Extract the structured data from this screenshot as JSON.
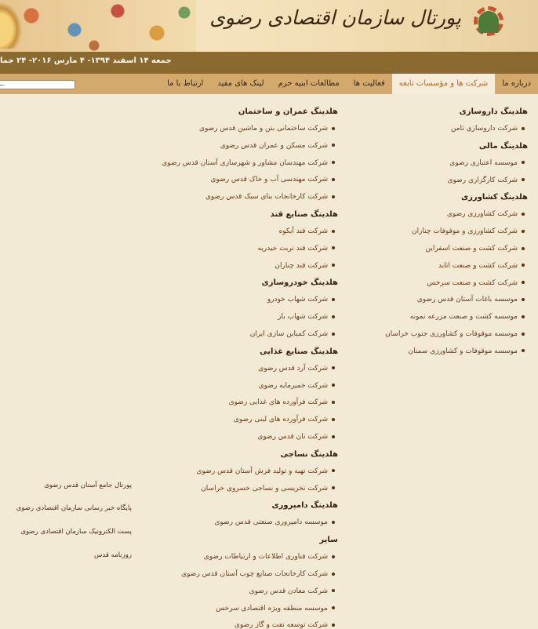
{
  "header": {
    "title": "پورتال سازمان اقتصادی رضوی"
  },
  "datebar": {
    "text": "جمعه ۱۴ اسفند ۱۳۹۴- ۴ مارس ۲۰۱۶- ۲۴ جما"
  },
  "nav": {
    "items": [
      "درباره ما",
      "شرکت ها و مؤسسات تابعه",
      "فعالیت ها",
      "مطالعات ابنیه حرم",
      "لینک های مفید",
      "ارتباط با ما"
    ],
    "search_value": "---"
  },
  "right_column": {
    "sections": [
      {
        "title": "هلدینگ داروسازی",
        "items": [
          "شرکت داروسازی ثامن"
        ]
      },
      {
        "title": "هلدینگ مالی",
        "items": [
          "موسسه اعتباری رضوی",
          "شرکت کارگزاری رضوی"
        ]
      },
      {
        "title": "هلدینگ کشاورزی",
        "items": [
          "شرکت کشاورزی رضوی",
          "شرکت کشاورزی و موقوفات چناران",
          "شرکت کشت و صنعت اسفراین",
          "شرکت کشت و صنعت اتابد",
          "شرکت کشت و صنعت سرخس",
          "موسسه باغات آستان قدس رضوی",
          "موسسه کشت و صنعت مزرعه نمونه",
          "موسسه موقوفات و کشاورزی جنوب خراسان",
          "موسسه موقوفات و کشاورزی سمنان"
        ]
      }
    ]
  },
  "middle_column": {
    "sections": [
      {
        "title": "هلدینگ عمران و ساختمان",
        "items": [
          "شرکت ساختمانی بتن و ماشین قدس رضوی",
          "شرکت مسکن و عمران قدس رضوی",
          "شرکت مهندسان مشاور و شهرسازی آستان قدس رضوی",
          "شرکت مهندسی آب و خاک قدس رضوی",
          "شرکت کارخانجات بنای سبک قدس رضوی"
        ]
      },
      {
        "title": "هلدینگ صنایع قند",
        "items": [
          "شرکت قند آبکوه",
          "شرکت قند تربت حیدریه",
          "شرکت قند چناران"
        ]
      },
      {
        "title": "هلدینگ خودروسازی",
        "items": [
          "شرکت شهاب خودرو",
          "شرکت شهاب بار",
          "شرکت کمباین سازی ایران"
        ]
      },
      {
        "title": "هلدینگ صنایع غذایی",
        "items": [
          "شرکت آرد قدس رضوی",
          "شرکت خمیرمایه رضوی",
          "شرکت فرآورده های غذایی رضوی",
          "شرکت فرآورده های لبنی رضوی",
          "شرکت نان قدس رضوی"
        ]
      },
      {
        "title": "هلدینگ نساجی",
        "items": [
          "شرکت تهیه و تولید فرش آستان قدس رضوی",
          "شرکت تخریسی و نساجی خسروی خراسان"
        ]
      },
      {
        "title": "هلدینگ دامپروری",
        "items": [
          "موسسه دامپروری صنعتی قدس رضوی"
        ]
      },
      {
        "title": "سایر",
        "items": [
          "شرکت فناوری اطلاعات و ارتباطات رضوی",
          "شرکت کارخانجات صنایع چوب آستان قدس رضوی",
          "شرکت معادن قدس رضوی",
          "موسسه منطقه ویژه اقتصادی سرخس",
          "شرکت توسعه نفت و گاز رضوی"
        ]
      }
    ]
  },
  "left_links": [
    "پورتال جامع آستان قدس رضوی",
    "پایگاه خبر رسانی سازمان اقتصادی رضوی",
    "پست الکترونیک سازمان اقتصادی رضوی",
    "روزنامه قدس"
  ]
}
